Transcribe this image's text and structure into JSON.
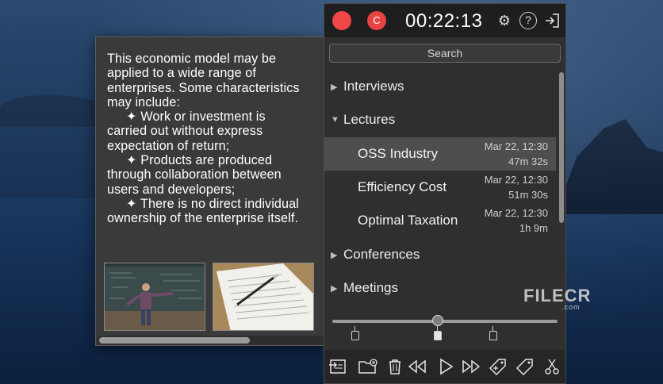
{
  "notes": {
    "lines": [
      {
        "text": "This economic model may be",
        "bullet": false
      },
      {
        "text": "applied to a wide range of",
        "bullet": false
      },
      {
        "text": "enterprises. Some characteristics",
        "bullet": false
      },
      {
        "text": "may include:",
        "bullet": false
      },
      {
        "text": "✦ Work or investment is",
        "bullet": true
      },
      {
        "text": "carried out without express",
        "bullet": false
      },
      {
        "text": "expectation of return;",
        "bullet": false
      },
      {
        "text": "✦ Products are produced",
        "bullet": true
      },
      {
        "text": "through collaboration between",
        "bullet": false
      },
      {
        "text": "users and developers;",
        "bullet": false
      },
      {
        "text": "✦ There is no direct individual",
        "bullet": true
      },
      {
        "text": "ownership of the enterprise itself.",
        "bullet": false
      }
    ]
  },
  "recorder": {
    "c_button": "C",
    "timer": "00:22:13",
    "search_label": "Search",
    "groups": {
      "interviews": "Interviews",
      "lectures": "Lectures",
      "conferences": "Conferences",
      "meetings": "Meetings"
    },
    "lecture_items": [
      {
        "title": "OSS Industry",
        "date": "Mar 22, 12:30",
        "duration": "47m 32s",
        "selected": true
      },
      {
        "title": "Efficiency Cost",
        "date": "Mar 22, 12:30",
        "duration": "51m 30s",
        "selected": false
      },
      {
        "title": "Optimal Taxation",
        "date": "Mar 22, 12:30",
        "duration": "1h 9m",
        "selected": false
      }
    ],
    "playback_position": 0.47
  },
  "watermark": {
    "brand": "FILECR",
    "domain": ".com"
  },
  "colors": {
    "record_red": "#f04848",
    "panel_bg": "#2f2f2f",
    "selected_row": "#4e4e4e"
  }
}
